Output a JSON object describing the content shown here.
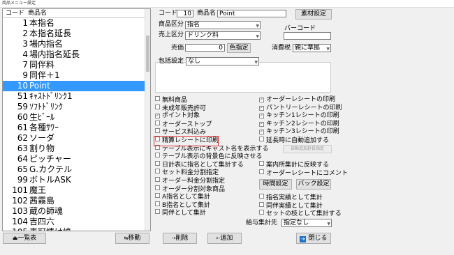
{
  "window": {
    "title": "商品メニュー設定"
  },
  "list": {
    "header_code": "コード",
    "header_name": "商品名",
    "items": [
      {
        "code": "1",
        "name": "本指名"
      },
      {
        "code": "2",
        "name": "本指名延長"
      },
      {
        "code": "3",
        "name": "場内指名"
      },
      {
        "code": "4",
        "name": "場内指名延長"
      },
      {
        "code": "7",
        "name": "同伴料"
      },
      {
        "code": "9",
        "name": "同伴＋1"
      },
      {
        "code": "10",
        "name": "Point"
      },
      {
        "code": "51",
        "name": "ｷｬｽﾄﾄﾞﾘﾝｸ1"
      },
      {
        "code": "59",
        "name": "ｿﾌﾄﾄﾞﾘﾝｸ"
      },
      {
        "code": "60",
        "name": "生ﾋﾞｰﾙ"
      },
      {
        "code": "61",
        "name": "各種ｻﾜｰ"
      },
      {
        "code": "62",
        "name": "ソーダ"
      },
      {
        "code": "63",
        "name": "割り物"
      },
      {
        "code": "64",
        "name": "ピッチャー"
      },
      {
        "code": "65",
        "name": "G.カクテル"
      },
      {
        "code": "99",
        "name": "ボトルASK"
      },
      {
        "code": "101",
        "name": "魔王"
      },
      {
        "code": "102",
        "name": "茜霧島"
      },
      {
        "code": "103",
        "name": "蔵の師魂"
      },
      {
        "code": "104",
        "name": "吉四六"
      },
      {
        "code": "105",
        "name": "麦冠情け嶋"
      }
    ],
    "selected_code": "10"
  },
  "form": {
    "code_label": "コード",
    "code_value": "10",
    "name_label": "商品名",
    "name_value": "Point",
    "material_button": "素材設定",
    "category_label": "商品区分",
    "category_value": "指名",
    "sales_label": "売上区分",
    "sales_value": "ドリンク料",
    "barcode_label": "バーコード",
    "barcode_value": "",
    "price_label": "売価",
    "price_value": "0",
    "color_button": "色指定",
    "tax_label": "消費税",
    "tax_value": "親に準拠",
    "package_label": "包括設定",
    "package_value": "なし"
  },
  "checks_left": [
    {
      "label": "無料商品",
      "checked": false
    },
    {
      "label": "未成年販売許可",
      "checked": false
    },
    {
      "label": "ポイント対象",
      "checked": true
    },
    {
      "label": "オーダーストップ",
      "checked": false
    },
    {
      "label": "サービス料込み",
      "checked": false
    },
    {
      "label": "精算レシートに印刷",
      "checked": false
    },
    {
      "label": "テーブル表示にキャスト名を表示する",
      "checked": false
    },
    {
      "label": "テーブル表示の背景色に反映させる",
      "checked": false
    },
    {
      "label": "日計表に指名として集計する",
      "checked": false
    },
    {
      "label": "セット料金分割指定",
      "checked": false
    },
    {
      "label": "オーダー料金分割指定",
      "checked": false
    },
    {
      "label": "オーダー分割対象商品",
      "checked": false
    },
    {
      "label": "A指名として集計",
      "checked": false
    },
    {
      "label": "B指名として集計",
      "checked": false
    },
    {
      "label": "同伴として集計",
      "checked": false
    }
  ],
  "checks_right_top": [
    {
      "label": "オーダーレシートの印刷",
      "checked": true
    },
    {
      "label": "パントリーレシートの印刷",
      "checked": true
    },
    {
      "label": "キッチン1レシートの印刷",
      "checked": true
    },
    {
      "label": "キッチン2レシートの印刷",
      "checked": true
    },
    {
      "label": "キッチン3レシートの印刷",
      "checked": true
    },
    {
      "label": "延長時に自動追加する",
      "checked": false
    }
  ],
  "auto_add_button": "自動追加延長指定",
  "checks_right_mid": [
    {
      "label": "案内所集計に反映する",
      "checked": false
    },
    {
      "label": "オーダーレシートにコメント",
      "checked": false
    }
  ],
  "time_button": "時間設定",
  "back_button": "バック設定",
  "checks_right_bottom": [
    {
      "label": "指名実績として集計",
      "checked": false
    },
    {
      "label": "同伴実績として集計",
      "checked": false
    },
    {
      "label": "セットの枝として集計する",
      "checked": false
    }
  ],
  "salary_label": "給与集計先",
  "salary_value": "指定なし",
  "footer": {
    "list_button": "一覧表",
    "move_button": "移動",
    "delete_button": "削除",
    "add_button": "追加",
    "close_button": "閉じる"
  },
  "colors": {
    "selection": "#3399ff",
    "highlight": "#e03030",
    "close_icon": "#1a73c9"
  }
}
